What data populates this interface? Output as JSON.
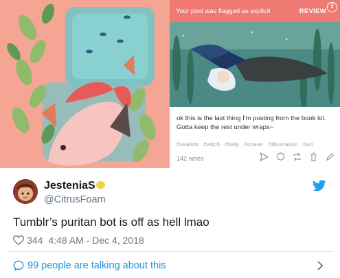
{
  "tumblr_post": {
    "flag_message": "Your post was flagged as explicit",
    "review_label": "REVIEW",
    "caption": "ok this is the last thing I'm posting from the book lol. Gotta keep the rest under wraps~",
    "tags": [
      "#sealion",
      "#witch",
      "#kelp",
      "#ocean",
      "#illustration",
      "#art"
    ],
    "notes": "142 notes"
  },
  "tweet": {
    "display_name": "JesteniaS",
    "handle": "@CitrusFoam",
    "text": "Tumblr’s puritan bot is off as hell lmao",
    "likes": "344",
    "timestamp": "4:48 AM - Dec 4, 2018",
    "talking_link": "99 people are talking about this"
  },
  "icons": {
    "brand": "twitter-bird-icon",
    "like": "heart-icon",
    "conversation": "speech-bubble-icon",
    "more": "chevron-right-icon"
  },
  "colors": {
    "twitter_blue": "#1da1f2",
    "link_blue": "#1b95e0",
    "secondary_text": "#657786",
    "flag_bar": "#ee7a73",
    "left_art_background": "#f4a593"
  }
}
